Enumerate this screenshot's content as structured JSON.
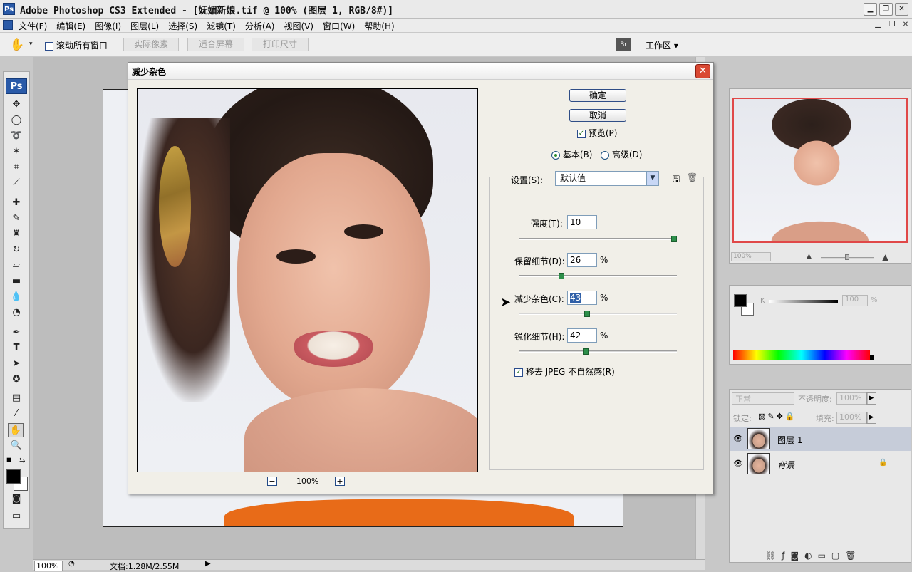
{
  "app": {
    "title": "Adobe Photoshop CS3 Extended - [妩媚新娘.tif @ 100% (图层 1, RGB/8#)]",
    "logo": "Ps",
    "minimize": "▁",
    "restore": "❐",
    "close": "✕"
  },
  "menu": {
    "items": [
      "文件(F)",
      "编辑(E)",
      "图像(I)",
      "图层(L)",
      "选择(S)",
      "滤镜(T)",
      "分析(A)",
      "视图(V)",
      "窗口(W)",
      "帮助(H)"
    ]
  },
  "options": {
    "scroll_all": "滚动所有窗口",
    "actual_pixels": "实际像素",
    "fit_screen": "适合屏幕",
    "print_size": "打印尺寸",
    "workspace": "工作区",
    "workspace_arrow": "▾"
  },
  "toolbox": {
    "logo": "Ps"
  },
  "dialog": {
    "title": "减少杂色",
    "close": "✕",
    "ok": "确定",
    "cancel": "取消",
    "preview_label": "预览(P)",
    "preview_checked": true,
    "mode_basic": "基本(B)",
    "mode_advanced": "高级(D)",
    "settings_label": "设置(S):",
    "settings_value": "默认值",
    "zoom": "100%",
    "zoom_out": "−",
    "zoom_in": "+",
    "strength_label": "强度(T):",
    "strength_value": "10",
    "strength_fraction": 1.0,
    "preserve_label": "保留细节(D):",
    "preserve_value": "26",
    "preserve_fraction": 0.26,
    "reduce_label": "减少杂色(C):",
    "reduce_value": "43",
    "reduce_fraction": 0.43,
    "sharpen_label": "锐化细节(H):",
    "sharpen_value": "42",
    "sharpen_fraction": 0.42,
    "percent": "%",
    "jpeg_label": "移去 JPEG 不自然感(R)",
    "jpeg_checked": true
  },
  "status": {
    "zoom": "100%",
    "doc": "文档:1.28M/2.55M"
  },
  "navigator": {
    "zoom": "100%"
  },
  "color": {
    "channel": "K",
    "value": "100",
    "percent": "%"
  },
  "layers": {
    "blend_mode": "正常",
    "opacity_label": "不透明度:",
    "opacity_value": "100%",
    "lock_label": "锁定:",
    "fill_label": "填充:",
    "fill_value": "100%",
    "items": [
      {
        "name": "图层 1",
        "selected": true
      },
      {
        "name": "背景",
        "selected": false
      }
    ]
  }
}
